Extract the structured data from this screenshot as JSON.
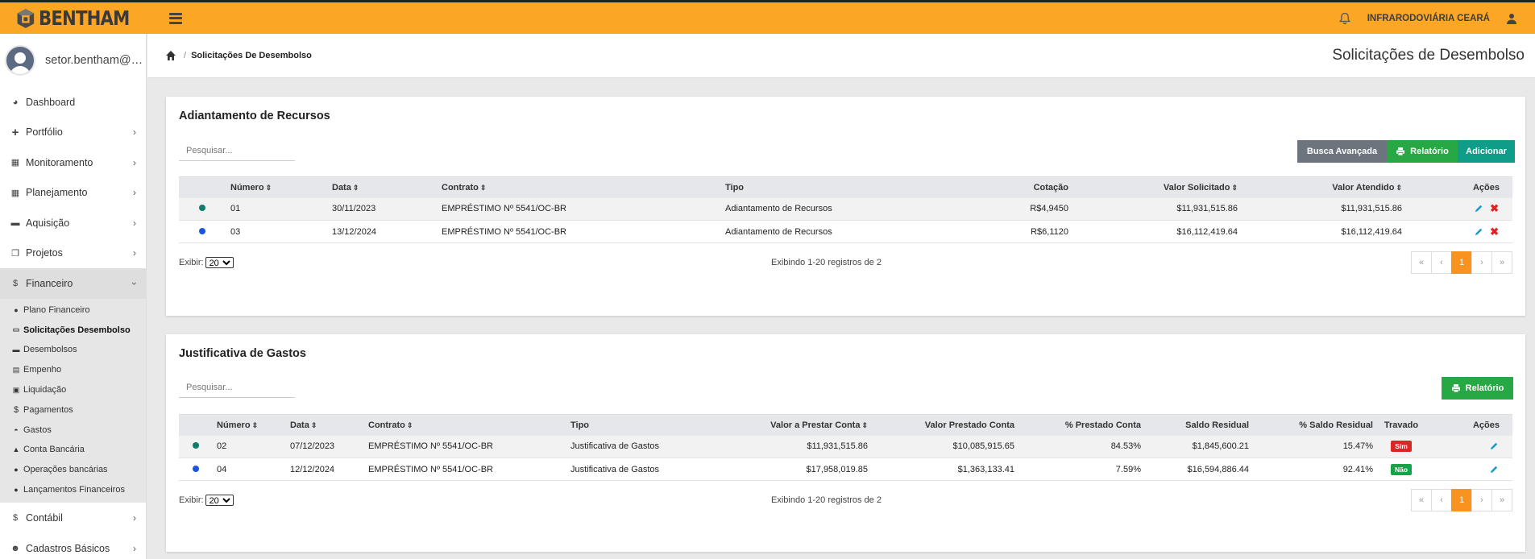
{
  "app": {
    "brand": "BENTHAM",
    "org_name": "INFRARODOVIÁRIA CEARÁ"
  },
  "sidebar": {
    "user": "setor.bentham@q...",
    "items": [
      {
        "label": "Dashboard",
        "icon": "dashboard-icon"
      },
      {
        "label": "Portfólio",
        "icon": "plus-icon"
      },
      {
        "label": "Monitoramento",
        "icon": "calendar-icon"
      },
      {
        "label": "Planejamento",
        "icon": "calendar-icon"
      },
      {
        "label": "Aquisição",
        "icon": "card-icon"
      },
      {
        "label": "Projetos",
        "icon": "copy-icon"
      },
      {
        "label": "Financeiro",
        "icon": "dollar-icon"
      },
      {
        "label": "Contábil",
        "icon": "dollar-icon"
      },
      {
        "label": "Cadastros Básicos",
        "icon": "users-icon"
      }
    ],
    "financeiro_sub": [
      {
        "label": "Plano Financeiro",
        "icon": "circle-icon"
      },
      {
        "label": "Solicitações Desembolso",
        "icon": "card-icon"
      },
      {
        "label": "Desembolsos",
        "icon": "card-icon"
      },
      {
        "label": "Empenho",
        "icon": "file-icon"
      },
      {
        "label": "Liquidação",
        "icon": "money-icon"
      },
      {
        "label": "Pagamentos",
        "icon": "dollar-icon"
      },
      {
        "label": "Gastos",
        "icon": "basket-icon"
      },
      {
        "label": "Conta Bancária",
        "icon": "bank-icon"
      },
      {
        "label": "Operações bancárias",
        "icon": "circle-icon"
      },
      {
        "label": "Lançamentos Financeiros",
        "icon": "circle-icon"
      }
    ]
  },
  "header": {
    "breadcrumb": "Solicitações De Desembolso",
    "page_title": "Solicitações de Desembolso"
  },
  "panel1": {
    "title": "Adiantamento de Recursos",
    "search_placeholder": "Pesquisar...",
    "btn_busca": "Busca Avançada",
    "btn_relatorio": "Relatório",
    "btn_adicionar": "Adicionar",
    "columns": [
      "Número",
      "Data",
      "Contrato",
      "Tipo",
      "Cotação",
      "Valor Solicitado",
      "Valor Atendido",
      "Ações"
    ],
    "rows": [
      {
        "dot": "#0d7d6c",
        "numero": "01",
        "data": "30/11/2023",
        "contrato": "EMPRÉSTIMO Nº 5541/OC-BR",
        "tipo": "Adiantamento de Recursos",
        "cotacao": "R$4,9450",
        "solicitado": "$11,931,515.86",
        "atendido": "$11,931,515.86"
      },
      {
        "dot": "#1a56db",
        "numero": "03",
        "data": "13/12/2024",
        "contrato": "EMPRÉSTIMO Nº 5541/OC-BR",
        "tipo": "Adiantamento de Recursos",
        "cotacao": "R$6,1120",
        "solicitado": "$16,112,419.64",
        "atendido": "$16,112,419.64"
      }
    ],
    "exibir_label": "Exibir:",
    "page_size": "20",
    "records_text": "Exibindo 1-20 registros de 2",
    "pager": [
      "«",
      "‹",
      "1",
      "›",
      "»"
    ]
  },
  "panel2": {
    "title": "Justificativa de Gastos",
    "search_placeholder": "Pesquisar...",
    "btn_relatorio": "Relatório",
    "columns": [
      "Número",
      "Data",
      "Contrato",
      "Tipo",
      "Valor a Prestar Conta",
      "Valor Prestado Conta",
      "% Prestado Conta",
      "Saldo Residual",
      "% Saldo Residual",
      "Travado",
      "Ações"
    ],
    "rows": [
      {
        "dot": "#0d7d6c",
        "numero": "02",
        "data": "07/12/2023",
        "contrato": "EMPRÉSTIMO Nº 5541/OC-BR",
        "tipo": "Justificativa de Gastos",
        "a_prestar": "$11,931,515.86",
        "prestado": "$10,085,915.65",
        "pct_prestado": "84.53%",
        "saldo": "$1,845,600.21",
        "pct_saldo": "15.47%",
        "travado": "Sim",
        "travado_color": "#dc2626"
      },
      {
        "dot": "#1a56db",
        "numero": "04",
        "data": "12/12/2024",
        "contrato": "EMPRÉSTIMO Nº 5541/OC-BR",
        "tipo": "Justificativa de Gastos",
        "a_prestar": "$17,958,019.85",
        "prestado": "$1,363,133.41",
        "pct_prestado": "7.59%",
        "saldo": "$16,594,886.44",
        "pct_saldo": "92.41%",
        "travado": "Não",
        "travado_color": "#16a34a"
      }
    ],
    "exibir_label": "Exibir:",
    "page_size": "20",
    "records_text": "Exibindo 1-20 registros de 2",
    "pager": [
      "«",
      "‹",
      "1",
      "›",
      "»"
    ]
  }
}
